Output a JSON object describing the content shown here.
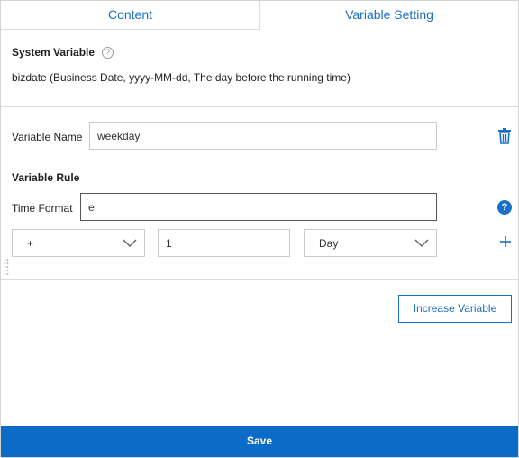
{
  "tabs": {
    "content_label": "Content",
    "variable_setting_label": "Variable Setting"
  },
  "system_variable": {
    "title": "System Variable",
    "help_glyph": "?",
    "description": "bizdate (Business Date, yyyy-MM-dd, The day before the running time)"
  },
  "variable": {
    "name_label": "Variable Name",
    "name_value": "weekday",
    "rule_title": "Variable Rule",
    "time_format_label": "Time Format",
    "time_format_value": "e",
    "operator_value": "+",
    "offset_value": "1",
    "unit_value": "Day",
    "help_glyph": "?"
  },
  "buttons": {
    "increase_label": "Increase Variable",
    "save_label": "Save"
  },
  "colors": {
    "accent": "#1a6fc7",
    "save_bg": "#0a6cc7"
  },
  "icons": {
    "trash": "trash-icon",
    "help": "help-icon",
    "plus": "plus-icon",
    "chevron": "chevron-down-icon",
    "grip": "drag-handle-icon"
  }
}
